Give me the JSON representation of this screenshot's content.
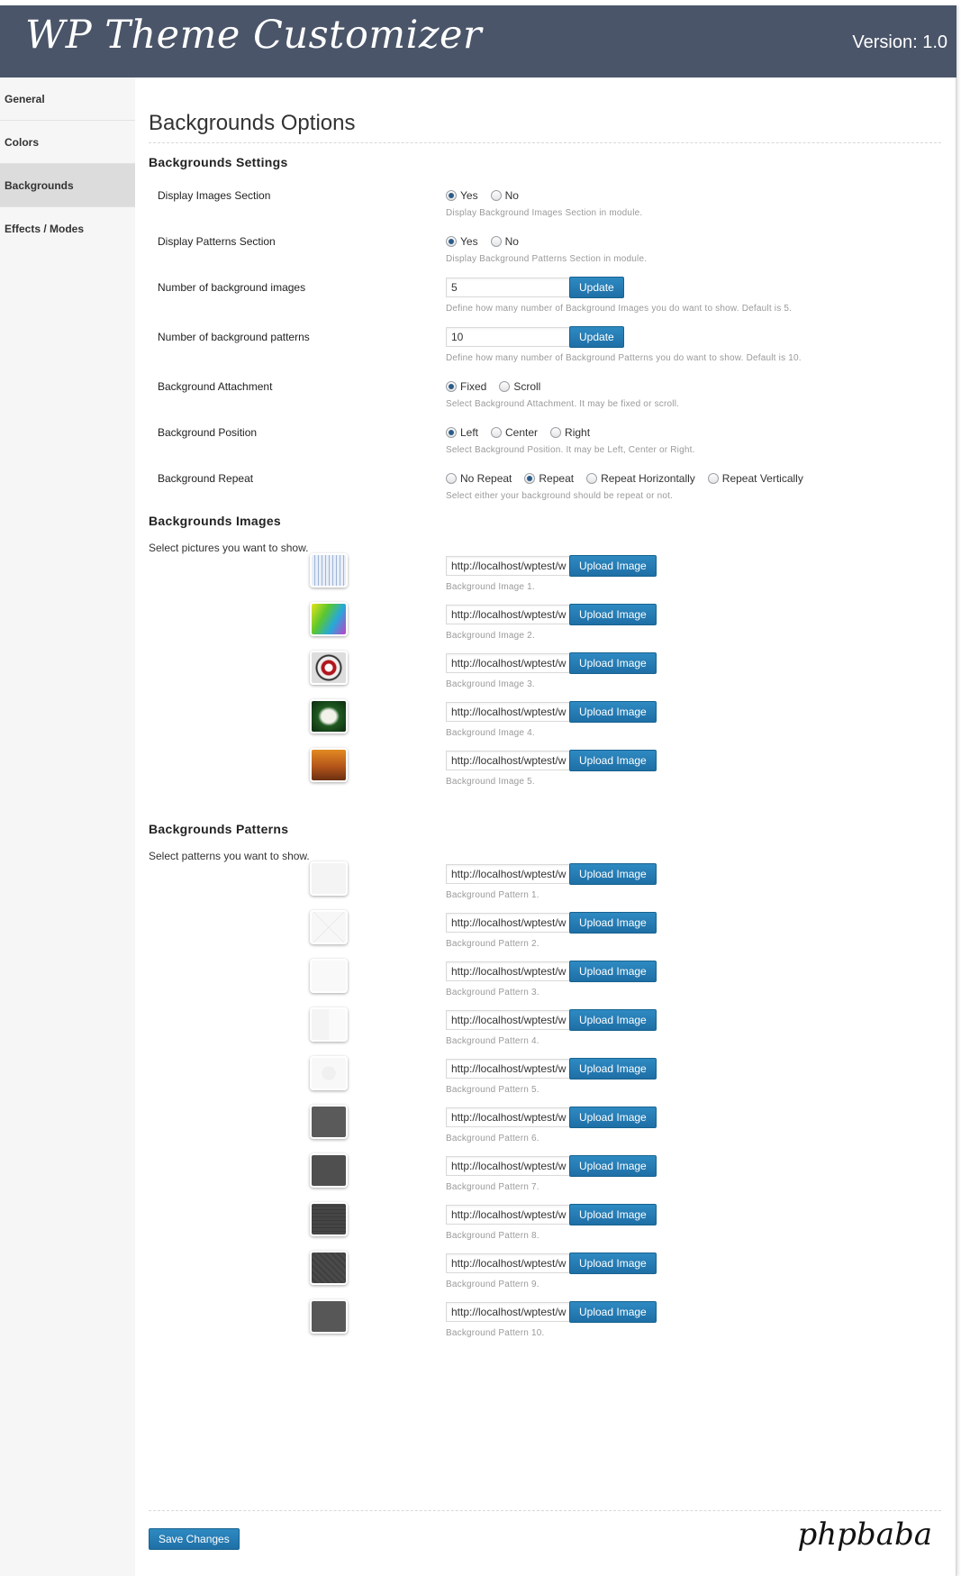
{
  "header": {
    "logo_text": "WP Theme Customizer",
    "version": "Version: 1.0"
  },
  "sidebar": {
    "items": [
      {
        "label": "General"
      },
      {
        "label": "Colors"
      },
      {
        "label": "Backgrounds"
      },
      {
        "label": "Effects / Modes"
      }
    ]
  },
  "main": {
    "title": "Backgrounds Options",
    "settings": {
      "title": "Backgrounds Settings",
      "display_images": {
        "label": "Display Images Section",
        "options": [
          "Yes",
          "No"
        ],
        "selected": "Yes",
        "hint": "Display Background Images Section in module."
      },
      "display_patterns": {
        "label": "Display Patterns Section",
        "options": [
          "Yes",
          "No"
        ],
        "selected": "Yes",
        "hint": "Display Background Patterns Section in module."
      },
      "num_images": {
        "label": "Number of background images",
        "value": "5",
        "button": "Update",
        "hint": "Define how many number of Background Images you do want to show. Default is 5."
      },
      "num_patterns": {
        "label": "Number of background patterns",
        "value": "10",
        "button": "Update",
        "hint": "Define how many number of Background Patterns you do want to show. Default is 10."
      },
      "attachment": {
        "label": "Background Attachment",
        "options": [
          "Fixed",
          "Scroll"
        ],
        "selected": "Fixed",
        "hint": "Select Background Attachment. It may be fixed or scroll."
      },
      "position": {
        "label": "Background Position",
        "options": [
          "Left",
          "Center",
          "Right"
        ],
        "selected": "Left",
        "hint": "Select Background Position. It may be Left, Center or Right."
      },
      "repeat": {
        "label": "Background Repeat",
        "options": [
          "No Repeat",
          "Repeat",
          "Repeat Horizontally",
          "Repeat Vertically"
        ],
        "selected": "Repeat",
        "hint": "Select either your background should be repeat or not."
      }
    },
    "images": {
      "title": "Backgrounds Images",
      "desc": "Select pictures you want to show.",
      "items": [
        {
          "url": "http://localhost/wptest/w",
          "button": "Upload Image",
          "caption": "Background Image 1."
        },
        {
          "url": "http://localhost/wptest/w",
          "button": "Upload Image",
          "caption": "Background Image 2."
        },
        {
          "url": "http://localhost/wptest/w",
          "button": "Upload Image",
          "caption": "Background Image 3."
        },
        {
          "url": "http://localhost/wptest/w",
          "button": "Upload Image",
          "caption": "Background Image 4."
        },
        {
          "url": "http://localhost/wptest/w",
          "button": "Upload Image",
          "caption": "Background Image 5."
        }
      ]
    },
    "patterns": {
      "title": "Backgrounds Patterns",
      "desc": "Select patterns you want to show.",
      "items": [
        {
          "url": "http://localhost/wptest/w",
          "button": "Upload Image",
          "caption": "Background Pattern 1."
        },
        {
          "url": "http://localhost/wptest/w",
          "button": "Upload Image",
          "caption": "Background Pattern 2."
        },
        {
          "url": "http://localhost/wptest/w",
          "button": "Upload Image",
          "caption": "Background Pattern 3."
        },
        {
          "url": "http://localhost/wptest/w",
          "button": "Upload Image",
          "caption": "Background Pattern 4."
        },
        {
          "url": "http://localhost/wptest/w",
          "button": "Upload Image",
          "caption": "Background Pattern 5."
        },
        {
          "url": "http://localhost/wptest/w",
          "button": "Upload Image",
          "caption": "Background Pattern 6."
        },
        {
          "url": "http://localhost/wptest/w",
          "button": "Upload Image",
          "caption": "Background Pattern 7."
        },
        {
          "url": "http://localhost/wptest/w",
          "button": "Upload Image",
          "caption": "Background Pattern 8."
        },
        {
          "url": "http://localhost/wptest/w",
          "button": "Upload Image",
          "caption": "Background Pattern 9."
        },
        {
          "url": "http://localhost/wptest/w",
          "button": "Upload Image",
          "caption": "Background Pattern 10."
        }
      ]
    },
    "save_label": "Save Changes",
    "brand": "phpbaba"
  },
  "colors": {
    "header_bg": "#4a5569",
    "button_blue": "#2478b0",
    "sidebar_bg": "#f6f6f6",
    "sidebar_active": "#dcdcdc"
  }
}
